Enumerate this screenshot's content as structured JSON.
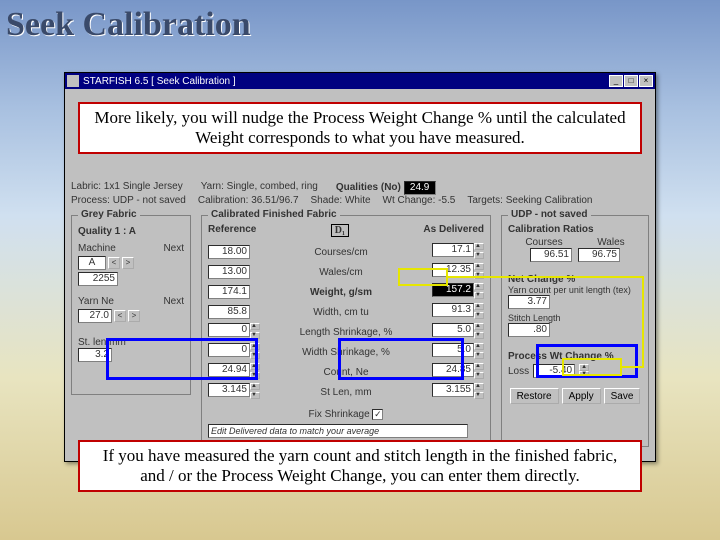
{
  "slide": {
    "title": "Seek Calibration"
  },
  "callouts": {
    "top": "More likely, you will nudge the Process Weight Change % until the calculated Weight corresponds to what you have measured.",
    "bottom": "If you have measured the yarn count and stitch length in the finished fabric, and / or the Process Weight Change, you can enter them directly."
  },
  "window": {
    "title": "STARFISH 6.5   [ Seek Calibration ]",
    "min": "_",
    "max": "□",
    "close": "×"
  },
  "info": {
    "labric": "1x1 Single Jersey",
    "process": "UDP - not saved",
    "yarn": "Single, combed, ring",
    "calibration": "36.51/96.7",
    "qualities_lbl": "Qualities (No)",
    "qualities": "24.9",
    "shade": "White",
    "wtchange_lbl": "Wt Change:",
    "wtchange": "-5.5",
    "targets": "Seeking Calibration"
  },
  "grey": {
    "title": "Grey Fabric",
    "quality": "Quality 1 : A",
    "next": "Next",
    "machine": "Machine",
    "machine_val": "A",
    "gauge": "2255",
    "yarnnc": "Yarn Ne",
    "yarn_val": "27.0",
    "stlen": "St. len mm",
    "stlen_val": "3.2"
  },
  "center": {
    "title": "Calibrated Finished Fabric",
    "ref": "Reference",
    "deliv": "As Delivered",
    "drag": "D₁",
    "rows": [
      {
        "ref": "18.00",
        "label": "Courses/cm",
        "del": "17.1"
      },
      {
        "ref": "13.00",
        "label": "Wales/cm",
        "del": "12.35"
      },
      {
        "ref": "174.1",
        "label": "Weight, g/sm",
        "del": "157.2",
        "hl": true
      },
      {
        "ref": "85.8",
        "label": "Width, cm tu",
        "del": "91.3"
      },
      {
        "ref": "0",
        "label": "Length Shrinkage, %",
        "del": "5.0",
        "spin_l": true
      },
      {
        "ref": "0",
        "label": "Width Shrinkage, %",
        "del": "5.0",
        "spin_l": true
      },
      {
        "ref": "24.94",
        "label": "Count, Ne",
        "del": "24.85",
        "spin_l": true
      },
      {
        "ref": "3.145",
        "label": "St Len, mm",
        "del": "3.155",
        "spin_l": true
      }
    ],
    "fix": "Fix Shrinkage",
    "edit": "Edit Delivered data to match your average"
  },
  "udp": {
    "title": "UDP - not saved",
    "calib": "Calibration Ratios",
    "courses": "Courses",
    "wales": "Wales",
    "courses_v": "96.51",
    "wales_v": "96.75",
    "net": "Net Change %",
    "yarn_lbl": "Yarn count per unit length (tex)",
    "yarn_v": "3.77",
    "stitch_lbl": "Stitch Length",
    "stitch_v": ".80",
    "proc": "Process Wt Change %",
    "loss": "Loss",
    "loss_v": "-5.40",
    "btns": {
      "restore": "Restore",
      "apply": "Apply",
      "save": "Save"
    }
  }
}
